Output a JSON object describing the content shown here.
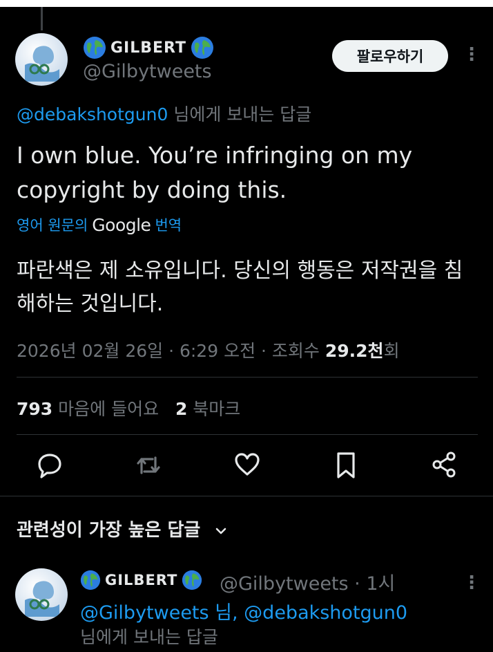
{
  "tweet": {
    "author_name": "GILBERT",
    "handle": "@Gilbytweets",
    "follow_label": "팔로우하기",
    "more_label": "⋮",
    "reply_to_handle": "@debakshotgun0",
    "reply_to_suffix": "님에게 보내는 답글",
    "text": "I own blue. You’re infringing on my copyright by doing this.",
    "translate_prefix": "영어 원문의",
    "translate_brand": "Google",
    "translate_suffix": "번역",
    "translated_text": "파란색은 제 소유입니다. 당신의 행동은 저작권을 침해하는 것입니다.",
    "timestamp": "2026년 02월 26일 · 6:29 오전 · 조회수",
    "views_value": "29.2천",
    "views_suffix": "회",
    "likes_count": "793",
    "likes_label": "마음에 들어요",
    "bookmarks_count": "2",
    "bookmarks_label": "북마크"
  },
  "actions": [
    {
      "icon": "reply-icon"
    },
    {
      "icon": "retweet-icon"
    },
    {
      "icon": "heart-icon"
    },
    {
      "icon": "bookmark-icon"
    },
    {
      "icon": "share-icon"
    }
  ],
  "replies_section": {
    "sort_label": "관련성이 가장 높은 답글"
  },
  "reply": {
    "author_name": "GILBERT",
    "meta": "@Gilbytweets · 1시",
    "mentions": "@Gilbytweets 님, @debakshotgun0",
    "suffix": "님에게 보내는 답글",
    "more_label": "⋮"
  },
  "colors": {
    "background": "#000000",
    "text": "#e7e9ea",
    "secondary": "#71767b",
    "link": "#1d9bf0",
    "follow_bg": "#eff3f4"
  }
}
